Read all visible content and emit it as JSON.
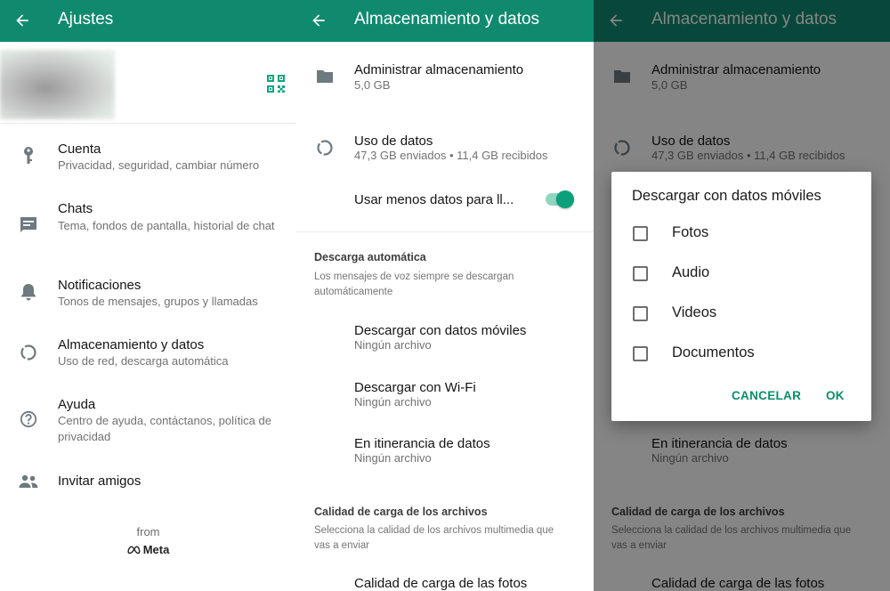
{
  "settings": {
    "title": "Ajustes",
    "items": [
      {
        "label": "Cuenta",
        "desc": "Privacidad, seguridad, cambiar número"
      },
      {
        "label": "Chats",
        "desc": "Tema, fondos de pantalla, historial de chat"
      },
      {
        "label": "Notificaciones",
        "desc": "Tonos de mensajes, grupos y llamadas"
      },
      {
        "label": "Almacenamiento y datos",
        "desc": "Uso de red, descarga automática"
      },
      {
        "label": "Ayuda",
        "desc": "Centro de ayuda, contáctanos, política de privacidad"
      },
      {
        "label": "Invitar amigos"
      }
    ],
    "from_label": "from",
    "meta_label": "Meta"
  },
  "storage": {
    "title": "Almacenamiento y datos",
    "manage": {
      "label": "Administrar almacenamiento",
      "value": "5,0 GB"
    },
    "usage": {
      "label": "Uso de datos",
      "value": "47,3 GB enviados • 11,4 GB recibidos"
    },
    "less_data": {
      "label": "Usar menos datos para ll...",
      "enabled": true
    },
    "auto_download": {
      "header": "Descarga automática",
      "desc": "Los mensajes de voz siempre se descargan automáticamente",
      "items": [
        {
          "label": "Descargar con datos móviles",
          "value": "Ningún archivo"
        },
        {
          "label": "Descargar con Wi-Fi",
          "value": "Ningún archivo"
        },
        {
          "label": "En itinerancia de datos",
          "value": "Ningún archivo"
        }
      ]
    },
    "upload_quality": {
      "header": "Calidad de carga de los archivos",
      "desc": "Selecciona la calidad de los archivos multimedia que vas a enviar",
      "photos_label": "Calidad de carga de las fotos"
    }
  },
  "dialog": {
    "title": "Descargar con datos móviles",
    "options": [
      {
        "label": "Fotos",
        "checked": false
      },
      {
        "label": "Audio",
        "checked": false
      },
      {
        "label": "Videos",
        "checked": false
      },
      {
        "label": "Documentos",
        "checked": false
      }
    ],
    "cancel": "CANCELAR",
    "ok": "OK"
  },
  "colors": {
    "header": "#0f8a6f",
    "accent": "#0a8f6c",
    "icon_gray": "#6d7a80"
  }
}
